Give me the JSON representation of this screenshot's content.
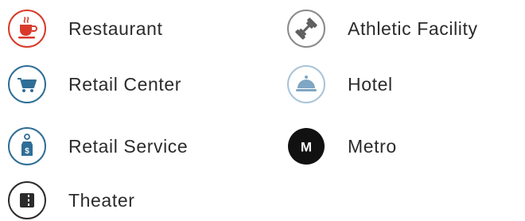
{
  "legend": {
    "items": [
      {
        "label": "Restaurant",
        "icon": "coffee-cup-icon",
        "color": "#d93a2b"
      },
      {
        "label": "Retail Center",
        "icon": "shopping-cart-icon",
        "color": "#2f6e96"
      },
      {
        "label": "Retail Service",
        "icon": "price-tag-icon",
        "color": "#2f6e96"
      },
      {
        "label": "Theater",
        "icon": "ticket-icon",
        "color": "#2b2b2b"
      },
      {
        "label": "Athletic Facility",
        "icon": "dumbbell-icon",
        "color": "#5f5f5f"
      },
      {
        "label": "Hotel",
        "icon": "service-bell-icon",
        "color": "#7fa6c3"
      },
      {
        "label": "Metro",
        "icon": "metro-icon",
        "color": "#111111",
        "badge_text": "M"
      }
    ]
  }
}
